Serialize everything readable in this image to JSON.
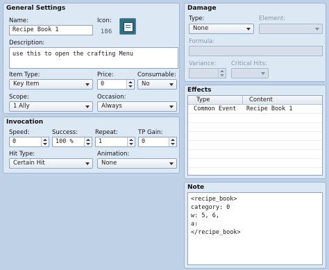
{
  "general": {
    "title": "General Settings",
    "name_label": "Name:",
    "name_value": "Recipe Book 1",
    "icon_label": "Icon:",
    "icon_index": "186",
    "icon_name": "book-icon",
    "description_label": "Description:",
    "description_value": "use this to open the crafting Menu",
    "item_type_label": "Item Type:",
    "item_type_value": "Key Item",
    "price_label": "Price:",
    "price_value": "0",
    "consumable_label": "Consumable:",
    "consumable_value": "No",
    "scope_label": "Scope:",
    "scope_value": "1 Ally",
    "occasion_label": "Occasion:",
    "occasion_value": "Always"
  },
  "invocation": {
    "title": "Invocation",
    "speed_label": "Speed:",
    "speed_value": "0",
    "success_label": "Success:",
    "success_value": "100 %",
    "repeat_label": "Repeat:",
    "repeat_value": "1",
    "tp_gain_label": "TP Gain:",
    "tp_gain_value": "0",
    "hit_type_label": "Hit Type:",
    "hit_type_value": "Certain Hit",
    "animation_label": "Animation:",
    "animation_value": "None"
  },
  "damage": {
    "title": "Damage",
    "type_label": "Type:",
    "type_value": "None",
    "element_label": "Element:",
    "element_value": "",
    "formula_label": "Formula:",
    "formula_value": "",
    "variance_label": "Variance:",
    "variance_value": "",
    "critical_label": "Critical Hits:",
    "critical_value": ""
  },
  "effects": {
    "title": "Effects",
    "columns": [
      "Type",
      "Content"
    ],
    "rows": [
      {
        "type": "Common Event",
        "content": "Recipe Book 1"
      }
    ]
  },
  "note": {
    "title": "Note",
    "lines": [
      "<recipe_book>",
      "category: 0",
      "w: 5, 6,",
      "a:",
      "</recipe_book>"
    ]
  },
  "colors": {
    "background": "#bfd1e6",
    "panel": "#dde8f5",
    "panel_border": "#9fb4cf",
    "icon_background": "#2b6f83"
  }
}
